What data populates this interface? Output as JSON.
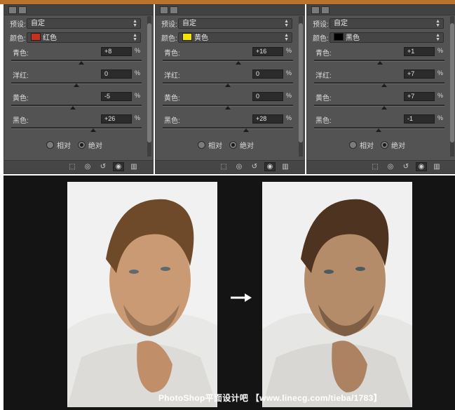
{
  "panels": [
    {
      "preset_label": "预设:",
      "preset_value": "自定",
      "color_label": "颜色:",
      "color_value": "红色",
      "swatch": "#c8301e",
      "sliders": [
        {
          "label": "青色:",
          "value": "+8",
          "unit": "%",
          "level": 0.54
        },
        {
          "label": "洋红:",
          "value": "0",
          "unit": "%",
          "level": 0.5
        },
        {
          "label": "黄色:",
          "value": "-5",
          "unit": "%",
          "level": 0.475
        },
        {
          "label": "黑色:",
          "value": "+26",
          "unit": "%",
          "level": 0.63
        }
      ],
      "radio_relative": "相对",
      "radio_absolute": "绝对"
    },
    {
      "preset_label": "预设:",
      "preset_value": "自定",
      "color_label": "颜色:",
      "color_value": "黄色",
      "swatch": "#f5e400",
      "sliders": [
        {
          "label": "青色:",
          "value": "+16",
          "unit": "%",
          "level": 0.58
        },
        {
          "label": "洋红:",
          "value": "0",
          "unit": "%",
          "level": 0.5
        },
        {
          "label": "黄色:",
          "value": "0",
          "unit": "%",
          "level": 0.5
        },
        {
          "label": "黑色:",
          "value": "+28",
          "unit": "%",
          "level": 0.64
        }
      ],
      "radio_relative": "相对",
      "radio_absolute": "绝对"
    },
    {
      "preset_label": "预设:",
      "preset_value": "自定",
      "color_label": "颜色:",
      "color_value": "黑色",
      "swatch": "#000000",
      "sliders": [
        {
          "label": "青色:",
          "value": "+1",
          "unit": "%",
          "level": 0.505
        },
        {
          "label": "洋红:",
          "value": "+7",
          "unit": "%",
          "level": 0.535
        },
        {
          "label": "黄色:",
          "value": "+7",
          "unit": "%",
          "level": 0.535
        },
        {
          "label": "黑色:",
          "value": "-1",
          "unit": "%",
          "level": 0.495
        }
      ],
      "radio_relative": "相对",
      "radio_absolute": "绝对"
    }
  ],
  "selected_mode": "absolute",
  "watermark": "PhotoShop平面设计吧 【www.linecg.com/tieba/1783】",
  "colors": {
    "panel_bg": "#535353",
    "accent_strip": "#b8742e",
    "canvas_bg": "#141414"
  }
}
